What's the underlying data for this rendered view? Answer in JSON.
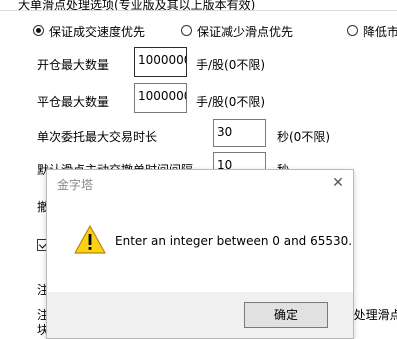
{
  "group": {
    "title": "大单滑点处理选项(专业版及其以上版本有效)"
  },
  "options": [
    {
      "label": "保证成交速度优先",
      "checked": true
    },
    {
      "label": "保证减少滑点优先",
      "checked": false
    },
    {
      "label": "降低市",
      "checked": false
    }
  ],
  "fields": {
    "open_max_qty": {
      "label": "开仓最大数量",
      "value": "1000000",
      "unit": "手/股(0不限)"
    },
    "close_max_qty": {
      "label": "平仓最大数量",
      "value": "1000000",
      "unit": "手/股(0不限)"
    },
    "order_max_time": {
      "label": "单次委托最大交易时长",
      "value": "30",
      "unit": "秒(0不限)"
    },
    "slippage_cancel": {
      "label": "默认滑点主动交撤单时间间隔",
      "value": "10",
      "unit": "秒"
    }
  },
  "partial": {
    "withdraw_label": "撤",
    "note1": "注",
    "note2": "注",
    "block_text": "块",
    "right_text": "E处理滑点"
  },
  "dialog": {
    "title": "金字塔",
    "message": "Enter an integer between 0 and 65530.",
    "ok_label": "确定",
    "close_glyph": "✕"
  },
  "colors": {
    "warning_fill": "#fcd116",
    "warning_stroke": "#b8860b"
  }
}
